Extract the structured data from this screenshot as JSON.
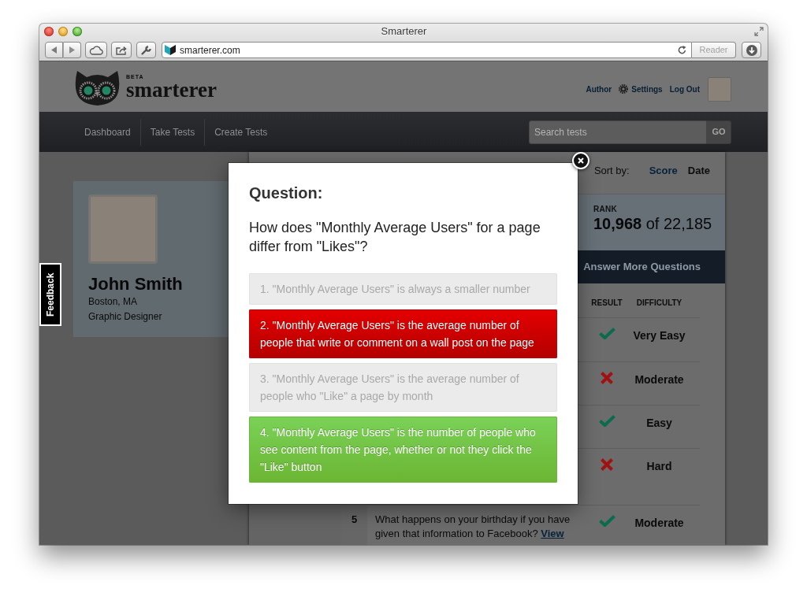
{
  "window": {
    "title": "Smarterer"
  },
  "toolbar": {
    "address": "smarterer.com",
    "reader": {
      "label": "Reader",
      "disabled": true
    }
  },
  "header": {
    "logo": {
      "tag": "BETA",
      "wordmark": "smarterer"
    },
    "links": [
      {
        "label": "Author",
        "kind": "plain"
      },
      {
        "label": "Settings",
        "kind": "with_icon"
      },
      {
        "label": "Log Out",
        "kind": "plain"
      }
    ]
  },
  "nav": {
    "items": [
      {
        "label": "Dashboard",
        "selected": false
      },
      {
        "label": "Take Tests",
        "selected": false
      },
      {
        "label": "Create Tests",
        "selected": false
      }
    ],
    "search": {
      "placeholder": "Search tests",
      "button": "GO"
    }
  },
  "feedback": {
    "label": "Feedback"
  },
  "profile": {
    "name": "John Smith",
    "location": "Boston, MA",
    "occupation": "Graphic Designer"
  },
  "sort": {
    "label": "Sort by:",
    "options": [
      {
        "label": "Score",
        "selected": true
      },
      {
        "label": "Date",
        "selected": false
      }
    ]
  },
  "rank": {
    "label": "RANK",
    "value": "**10,968** of 22,185"
  },
  "answer_button": {
    "label": "Answer More Questions"
  },
  "table": {
    "columns": [
      {
        "label": "RESULT"
      },
      {
        "label": "DIFFICULTY"
      }
    ],
    "rows": [
      {
        "correct": true,
        "difficulty": "Very Easy"
      },
      {
        "correct": false,
        "difficulty": "Moderate"
      },
      {
        "correct": true,
        "difficulty": "Easy"
      },
      {
        "correct": false,
        "difficulty": "Hard"
      },
      {
        "number": "5",
        "question": "What happens on your birthday if you have given that information to Facebook?",
        "link": "View",
        "correct": true,
        "difficulty": "Moderate"
      }
    ]
  },
  "modal": {
    "heading": "Question:",
    "question": "How does \"Monthly Average Users\" for a page differ from \"Likes\"?",
    "options": [
      {
        "label": "1. \"Monthly Average Users\" is always a smaller number",
        "kind": "neutral"
      },
      {
        "label": "2. \"Monthly Average Users\" is the average number of people that write or comment on a wall post on the page",
        "kind": "incorrect"
      },
      {
        "label": "3. \"Monthly Average Users\" is the average number of people who \"Like\" a page by month",
        "kind": "neutral"
      },
      {
        "label": "4. \"Monthly Average Users\" is the number of people who see content from the page, whether or not they click the \"Like\" button",
        "kind": "correct"
      }
    ]
  }
}
